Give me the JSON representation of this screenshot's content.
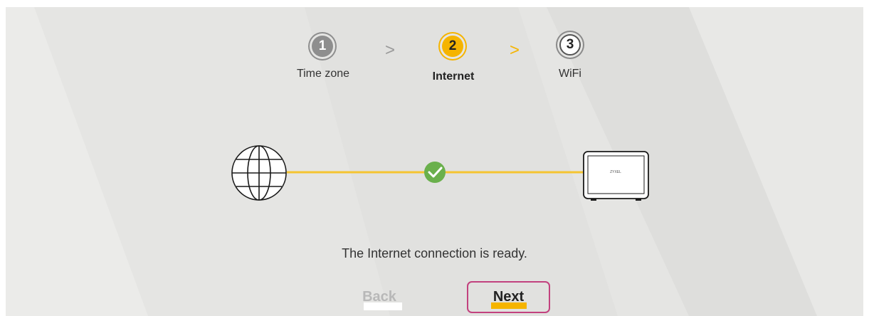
{
  "wizard": {
    "steps": [
      {
        "number": "1",
        "label": "Time zone",
        "state": "done"
      },
      {
        "number": "2",
        "label": "Internet",
        "state": "active"
      },
      {
        "number": "3",
        "label": "WiFi",
        "state": "todo"
      }
    ],
    "separators": [
      ">",
      ">"
    ]
  },
  "diagram": {
    "globe_icon": "globe-icon",
    "check_icon": "check-icon",
    "router_icon": "router-icon",
    "router_brand": "ZYXEL",
    "line_color": "#f5c431",
    "check_color": "#6ab04c"
  },
  "status": {
    "message": "The Internet connection is ready."
  },
  "buttons": {
    "back_label": "Back",
    "next_label": "Next"
  },
  "colors": {
    "accent": "#f5b400",
    "focus_outline": "#c2417e",
    "done_step": "#8e8e8e"
  }
}
